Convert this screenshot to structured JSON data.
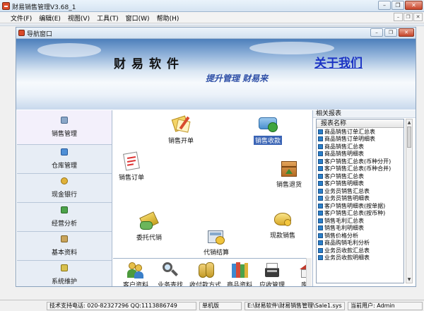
{
  "app": {
    "title": "财易销售管理V3.68_1"
  },
  "window_buttons": {
    "minimize": "–",
    "restore": "❐",
    "close": "✕"
  },
  "menu": {
    "items": [
      "文件(F)",
      "编辑(E)",
      "视图(V)",
      "工具(T)",
      "窗口(W)",
      "帮助(H)"
    ],
    "right_buttons": [
      "–",
      "❐",
      "✕"
    ]
  },
  "child_window": {
    "title": "导航窗口",
    "buttons": [
      "–",
      "❐",
      "✕"
    ]
  },
  "banner": {
    "brand": "财易软件",
    "slogan": "提升管理 财易来",
    "about": "关于我们"
  },
  "leftnav": {
    "items": [
      {
        "label": "销售管理",
        "icon": "sales-icon",
        "active": true
      },
      {
        "label": "仓库管理",
        "icon": "warehouse-icon",
        "active": false
      },
      {
        "label": "现金银行",
        "icon": "cash-icon",
        "active": false
      },
      {
        "label": "经营分析",
        "icon": "chart-icon",
        "active": false
      },
      {
        "label": "基本资料",
        "icon": "data-icon",
        "active": false
      },
      {
        "label": "系统维护",
        "icon": "tools-icon",
        "active": false
      }
    ]
  },
  "center": {
    "icons": [
      {
        "label": "销售开单",
        "icon": "sales-invoice-icon"
      },
      {
        "label": "销售收款",
        "icon": "sales-receipt-icon",
        "selected": true
      },
      {
        "label": "销售订单",
        "icon": "sales-order-icon"
      },
      {
        "label": "销售退货",
        "icon": "sales-return-icon"
      },
      {
        "label": "委托代销",
        "icon": "consignment-icon"
      },
      {
        "label": "现款销售",
        "icon": "cash-sale-icon"
      },
      {
        "label": "代销结算",
        "icon": "consignment-settle-icon"
      }
    ]
  },
  "shortcuts": {
    "items": [
      {
        "label": "客户资料",
        "icon": "customer-icon"
      },
      {
        "label": "业务查找",
        "icon": "search-icon"
      },
      {
        "label": "收付款方式",
        "icon": "money-icon"
      },
      {
        "label": "商品资料",
        "icon": "books-icon"
      },
      {
        "label": "应收管理",
        "icon": "receivable-icon"
      },
      {
        "label": "库存",
        "icon": "warehouse-icon"
      }
    ]
  },
  "reports": {
    "title": "相关报表",
    "header": "报表名称",
    "rows": [
      "商品销售订单汇总表",
      "商品销售订单明细表",
      "商品销售汇总表",
      "商品销售明细表",
      "客户销售汇总表(币种分开)",
      "客户销售汇总表(币种合并)",
      "客户销售汇总表",
      "客户销售明细表",
      "业务员销售汇总表",
      "业务员销售明细表",
      "客户销售明细表(按单据)",
      "客户销售汇总表(按币种)",
      "销售毛利汇总表",
      "销售毛利明细表",
      "销售价格分析",
      "商品购销毛利分析",
      "业务员收款汇总表",
      "业务员收款明细表"
    ]
  },
  "statusbar": {
    "support": "技术支持电话: 020-82327296 QQ:1113886749",
    "mode": "单机版",
    "path": "E:\\财易软件\\财易销售管理\\Sale1.sys",
    "user": "当前用户: Admin"
  }
}
